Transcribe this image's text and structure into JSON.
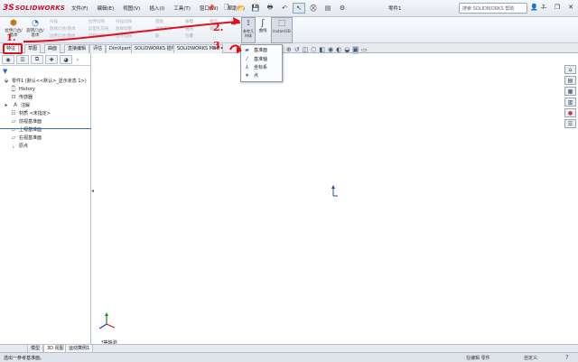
{
  "app": {
    "logo_ds": "3S",
    "logo_name": "SOLIDWORKS",
    "doc_title": "零件1"
  },
  "menu": [
    "文件(F)",
    "编辑(E)",
    "视图(V)",
    "插入(I)",
    "工具(T)",
    "窗口(W)",
    "帮助(H)"
  ],
  "search": {
    "placeholder": "搜索 SOLIDWORKS 帮助"
  },
  "ribbon": {
    "extrude_boss": "拉伸凸台/基体",
    "revolve_boss": "旋转凸台/基体",
    "disabled": [
      "扫描",
      "放样凸台/基体",
      "边界凸台/基体",
      "拉伸切除",
      "异型孔向导",
      "旋转切除",
      "扫描切除",
      "放样切割",
      "边界切除",
      "圆角",
      "线性阵列",
      "筋",
      "拔模",
      "抽壳",
      "包覆",
      "相交",
      "镜向"
    ],
    "ref_geometry": "参考几何体",
    "curves": "曲线",
    "instant3d": "Instant3D"
  },
  "tabs": [
    "特征",
    "草图",
    "曲面",
    "直接编辑",
    "评估",
    "DimXpert",
    "SOLIDWORKS 插件",
    "SOLIDWORKS MBD"
  ],
  "ref_menu": [
    {
      "label": "基准面",
      "icon": "plane-icon"
    },
    {
      "label": "基准轴",
      "icon": "axis-icon"
    },
    {
      "label": "坐标系",
      "icon": "coordinate-system-icon"
    },
    {
      "label": "点",
      "icon": "point-icon"
    }
  ],
  "tree": {
    "root": "零件1 (默认<<默认>_显示状态 1>)",
    "items": [
      {
        "label": "History",
        "icon": "history-icon"
      },
      {
        "label": "传感器",
        "icon": "sensor-icon"
      },
      {
        "label": "注解",
        "icon": "annotation-icon",
        "expandable": true
      },
      {
        "label": "材质 <未指定>",
        "icon": "material-icon"
      },
      {
        "label": "前视基准面",
        "icon": "plane-icon"
      },
      {
        "label": "上视基准面",
        "icon": "plane-icon"
      },
      {
        "label": "右视基准面",
        "icon": "plane-icon"
      },
      {
        "label": "原点",
        "icon": "origin-icon"
      }
    ]
  },
  "viewport": {
    "view_label": "*等轴测"
  },
  "bottom_tabs": [
    "模型",
    "3D 视图",
    "运动算例1"
  ],
  "status": {
    "left": "选出一参考基准面。",
    "right": "在编辑 零件",
    "unit": "自定义"
  },
  "annotations": {
    "a1": "1.",
    "a2": "2.",
    "a3": "3."
  },
  "colors": {
    "annotation": "#e0101a",
    "brand": "#c8102e",
    "selection": "#3a70b8"
  }
}
